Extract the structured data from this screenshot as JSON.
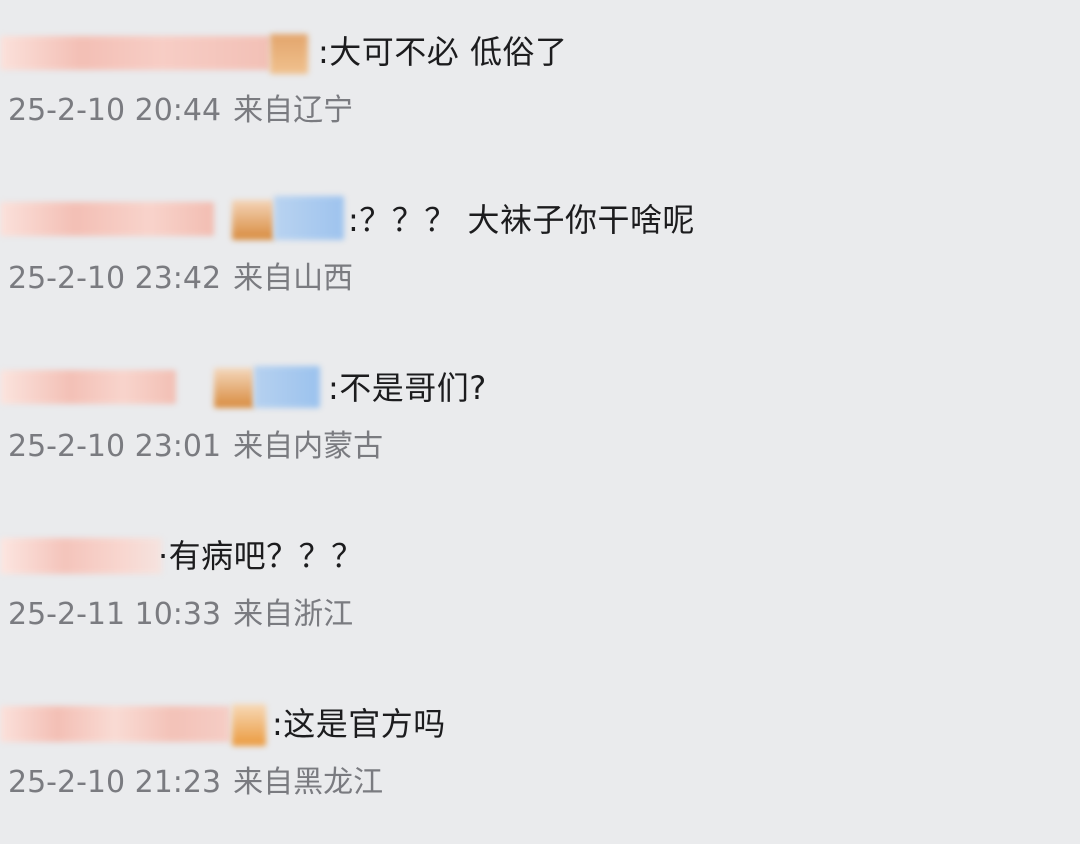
{
  "comments": [
    {
      "text": ":大可不必 低俗了",
      "time": "25-2-10 20:44",
      "location": "来自辽宁"
    },
    {
      "text": ":？？？ 大袜子你干啥呢",
      "time": "25-2-10 23:42",
      "location": "来自山西"
    },
    {
      "text": ":不是哥们?",
      "time": "25-2-10 23:01",
      "location": "来自内蒙古"
    },
    {
      "text": "·有病吧？？？",
      "time": "25-2-11 10:33",
      "location": "来自浙江"
    },
    {
      "text": ":这是官方吗",
      "time": "25-2-10 21:23",
      "location": "来自黑龙江"
    }
  ],
  "colors": {
    "background": "#eaebed",
    "text": "#1c1c1e",
    "meta": "#7a7b80",
    "blur_pink": "#f3c4bc",
    "blur_orange": "#e49a48",
    "blur_blue": "#9fc4ee"
  }
}
